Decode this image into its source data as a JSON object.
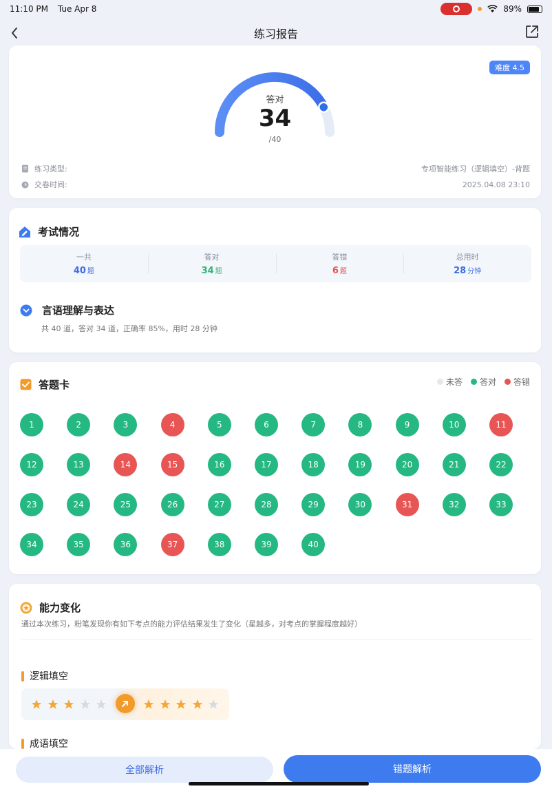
{
  "status_bar": {
    "time": "11:10 PM",
    "date": "Tue Apr 8",
    "battery": "89%"
  },
  "nav": {
    "title": "练习报告",
    "back_icon": "chevron-left-icon",
    "share_icon": "share-icon"
  },
  "score_card": {
    "difficulty": "难度 4.5",
    "label": "答对",
    "score": "34",
    "total": "/40",
    "progress": 0.85,
    "type_label": "练习类型:",
    "type_value": "专项智能练习（逻辑填空）-背题",
    "time_label": "交卷时间:",
    "time_value": "2025.04.08 23:10"
  },
  "exam": {
    "title": "考试情况",
    "stats": [
      {
        "label": "一共",
        "value": "40",
        "unit": "题",
        "color": "#3f6fe0"
      },
      {
        "label": "答对",
        "value": "34",
        "unit": "题",
        "color": "#2fb57a"
      },
      {
        "label": "答错",
        "value": "6",
        "unit": "题",
        "color": "#e85555"
      },
      {
        "label": "总用时",
        "value": "28",
        "unit": "分钟",
        "color": "#3f6fe0"
      }
    ],
    "section_title": "言语理解与表达",
    "section_summary": "共 40 道，答对 34 道，正确率 85%，用时 28 分钟"
  },
  "answer_card": {
    "title": "答题卡",
    "legend": [
      {
        "label": "未答",
        "color": "#e6e8ec"
      },
      {
        "label": "答对",
        "color": "#25b882"
      },
      {
        "label": "答错",
        "color": "#e85555"
      }
    ],
    "colors": {
      "correct": "#25b882",
      "wrong": "#e85555"
    },
    "wrong": [
      4,
      11,
      14,
      15,
      31,
      37
    ],
    "total": 40
  },
  "ability": {
    "title": "能力变化",
    "description": "通过本次练习，粉笔发现你有如下考点的能力评估结果发生了变化（星越多，对考点的掌握程度越好）",
    "categories": [
      {
        "name": "逻辑填空",
        "before_stars": 3,
        "after_stars": 4,
        "max_stars": 5
      },
      {
        "name": "成语填空"
      }
    ]
  },
  "actions": {
    "all_analysis": "全部解析",
    "wrong_analysis": "错题解析"
  }
}
